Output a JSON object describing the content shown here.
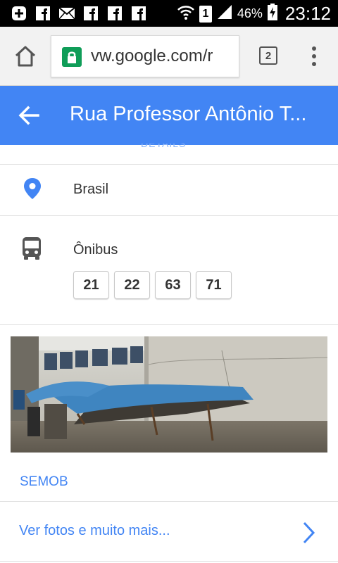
{
  "status_bar": {
    "left_icons": [
      "plus-box-icon",
      "facebook-icon",
      "mail-icon",
      "facebook-icon",
      "facebook-icon",
      "facebook-icon"
    ],
    "sim_slot": "1",
    "battery_percent": "46%",
    "time": "23:12"
  },
  "browser": {
    "url": "vw.google.com/r",
    "tab_count": "2"
  },
  "app_bar": {
    "title": "Rua Professor Antônio T..."
  },
  "place": {
    "cutoff_label": "DETAILS",
    "country": "Brasil",
    "transit": {
      "label": "Ônibus",
      "lines": [
        "21",
        "22",
        "63",
        "71"
      ]
    },
    "photo_credit": "SEMOB",
    "more_link": "Ver fotos e muito mais..."
  },
  "colors": {
    "app_bar": "#4285f4",
    "link": "#4285f4",
    "lock": "#0f9d58"
  }
}
